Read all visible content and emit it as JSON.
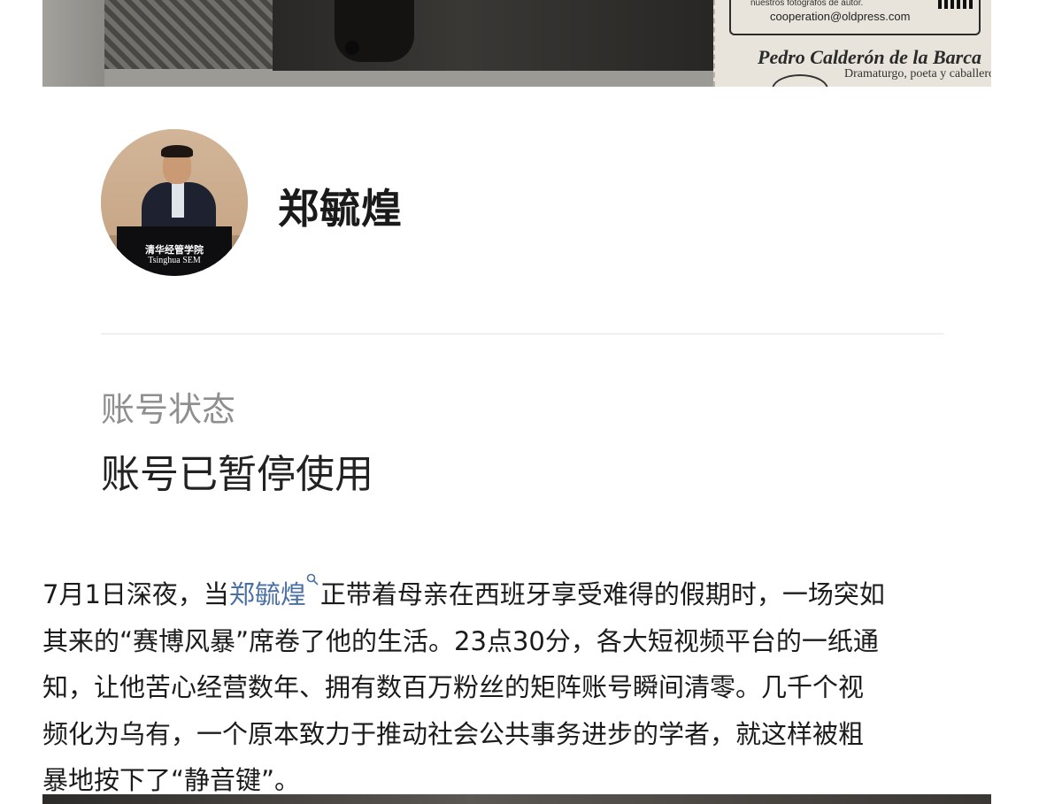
{
  "top_image": {
    "stamp_small_text": "nuestros fotógrafos de autor.",
    "stamp_email": "cooperation@oldpress.com",
    "stamp_name": "Pedro Calderón de la Barca",
    "stamp_subtitle": "Dramaturgo, poeta y caballero"
  },
  "profile": {
    "avatar_caption_line1": "清华经管学院",
    "avatar_caption_line2": "Tsinghua SEM",
    "name": "郑毓煌"
  },
  "account": {
    "status_label": "账号状态",
    "status_value": "账号已暂停使用"
  },
  "article": {
    "line1_before": "7月1日深夜，当",
    "line1_link": "郑毓煌",
    "line1_after": "正带着母亲在西班牙享受难得的假期时，一场突如",
    "line2": "其来的“赛博风暴”席卷了他的生活。23点30分，各大短视频平台的一纸通",
    "line3": "知，让他苦心经营数年、拥有数百万粉丝的矩阵账号瞬间清零。几千个视",
    "line4": "频化为乌有，一个原本致力于推动社会公共事务进步的学者，就这样被粗",
    "line5": "暴地按下了“静音键”。"
  },
  "colors": {
    "link": "#4a6fa5",
    "status_label": "#8f8f8f",
    "divider": "#e4e4e4"
  }
}
